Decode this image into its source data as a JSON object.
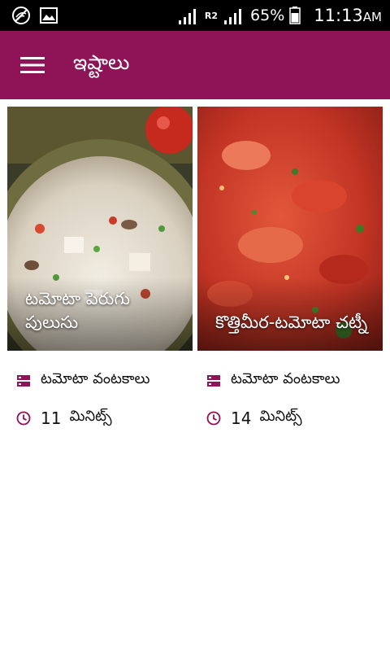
{
  "status_bar": {
    "battery_percent": "65%",
    "network_label": "R2",
    "time": "11:13",
    "ampm": "AM",
    "icons": [
      "wifi-disabled-icon",
      "image-icon",
      "signal-icon",
      "signal-icon",
      "battery-icon"
    ]
  },
  "app_bar": {
    "title": "ఇష్టాలు",
    "menu_icon": "hamburger-menu-icon",
    "background": "#8e1457"
  },
  "recipes": [
    {
      "title": "టమోటా పెరుగు పులుసు",
      "category": "టమోటా వంటకాలు",
      "time_value": "11",
      "time_unit": "మినిట్స్"
    },
    {
      "title": "కొత్తిమీర-టమోటా చట్నీ",
      "category": "టమోటా వంటకాలు",
      "time_value": "14",
      "time_unit": "మినిట్స్"
    }
  ],
  "colors": {
    "accent": "#8e1457",
    "icon_accent": "#8e1457",
    "text": "#111111"
  }
}
